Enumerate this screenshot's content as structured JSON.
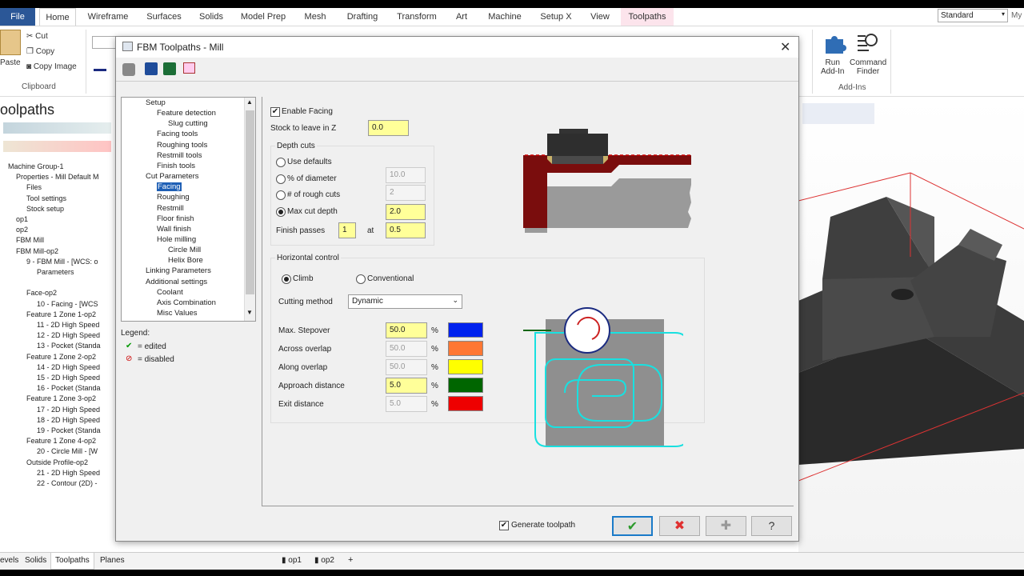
{
  "ribbon": {
    "tabs": [
      "File",
      "Home",
      "Wireframe",
      "Surfaces",
      "Solids",
      "Model Prep",
      "Mesh",
      "Drafting",
      "Transform",
      "Art",
      "Machine",
      "Setup X",
      "View",
      "Toolpaths"
    ],
    "style_select": "Standard",
    "clipboard": {
      "paste": "Paste",
      "cut": "Cut",
      "copy": "Copy",
      "copy_image": "Copy Image",
      "group": "Clipboard"
    },
    "addins": {
      "run": "Run\nAdd-In",
      "finder": "Command\nFinder",
      "group": "Add-Ins"
    },
    "my": "My"
  },
  "manager": {
    "title": "oolpaths",
    "items": [
      "Machine Group-1",
      "Properties - Mill Default M",
      "Files",
      "Tool settings",
      "Stock setup",
      "op1",
      "op2",
      "FBM Mill",
      "FBM Mill-op2",
      "9 - FBM Mill - [WCS: o",
      "Parameters",
      "",
      "Face-op2",
      "10 - Facing - [WCS",
      "Feature 1 Zone 1-op2",
      "11 - 2D High Speed",
      "12 - 2D High Speed",
      "13 - Pocket (Standa",
      "Feature 1 Zone 2-op2",
      "14 - 2D High Speed",
      "15 - 2D High Speed",
      "16 - Pocket (Standa",
      "Feature 1 Zone 3-op2",
      "17 - 2D High Speed",
      "18 - 2D High Speed",
      "19 - Pocket (Standa",
      "Feature 1 Zone 4-op2",
      "20 - Circle Mill - [W",
      "Outside Profile-op2",
      "21 - 2D High Speed",
      "22 - Contour (2D) -"
    ]
  },
  "statusbar": {
    "tabs": [
      "evels",
      "Solids",
      "Toolpaths",
      "Planes"
    ],
    "views": [
      "op1",
      "op2",
      "+"
    ]
  },
  "dialog": {
    "title": "FBM Toolpaths - Mill",
    "tree": [
      "Setup",
      "Feature detection",
      "Slug cutting",
      "Facing tools",
      "Roughing tools",
      "Restmill tools",
      "Finish tools",
      "Cut Parameters",
      "Facing",
      "Roughing",
      "Restmill",
      "Floor finish",
      "Wall finish",
      "Hole milling",
      "Circle Mill",
      "Helix Bore",
      "Linking Parameters",
      "Additional settings",
      "Coolant",
      "Axis Combination",
      "Misc Values"
    ],
    "legend": {
      "title": "Legend:",
      "edited": "= edited",
      "disabled": "= disabled"
    },
    "enable_facing": "Enable Facing",
    "stock_label": "Stock to leave in Z",
    "stock_value": "0.0",
    "depth": {
      "group": "Depth cuts",
      "use_defaults": "Use defaults",
      "pct_diam": "% of diameter",
      "pct_diam_val": "10.0",
      "rough_cuts": "# of rough cuts",
      "rough_cuts_val": "2",
      "max_cut": "Max cut depth",
      "max_cut_val": "2.0",
      "finish_passes": "Finish passes",
      "finish_passes_val": "1",
      "at": "at",
      "at_val": "0.5"
    },
    "horizontal": {
      "group": "Horizontal control",
      "climb": "Climb",
      "conventional": "Conventional",
      "method_label": "Cutting method",
      "method_value": "Dynamic",
      "rows": [
        {
          "label": "Max. Stepover",
          "value": "50.0",
          "unit": "%",
          "color": "#0022ee",
          "active": true
        },
        {
          "label": "Across overlap",
          "value": "50.0",
          "unit": "%",
          "color": "#ff7733",
          "active": false
        },
        {
          "label": "Along overlap",
          "value": "50.0",
          "unit": "%",
          "color": "#ffff00",
          "active": false
        },
        {
          "label": "Approach distance",
          "value": "5.0",
          "unit": "%",
          "color": "#006600",
          "active": true
        },
        {
          "label": "Exit distance",
          "value": "5.0",
          "unit": "%",
          "color": "#ee0000",
          "active": false
        }
      ]
    },
    "generate": "Generate toolpath",
    "buttons": {
      "ok": "✔",
      "cancel": "✖",
      "add": "✚",
      "help": "?"
    }
  }
}
